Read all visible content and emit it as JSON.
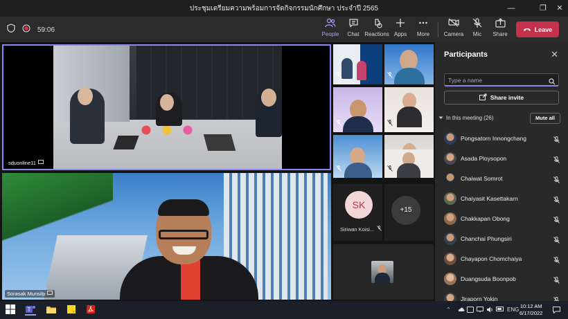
{
  "window": {
    "title": "ประชุมเตรียมความพร้อมการจัดกิจกรรมนักศึกษา ประจำปี 2565",
    "controls": [
      "minimize",
      "maximize",
      "close"
    ]
  },
  "toolbar": {
    "timer": "59:06",
    "items": [
      {
        "label": "People",
        "icon": "people-icon",
        "active": true
      },
      {
        "label": "Chat",
        "icon": "chat-icon"
      },
      {
        "label": "Reactions",
        "icon": "reactions-icon"
      },
      {
        "label": "Apps",
        "icon": "apps-icon"
      },
      {
        "label": "More",
        "icon": "more-icon"
      },
      {
        "label": "Camera",
        "icon": "camera-icon"
      },
      {
        "label": "Mic",
        "icon": "mic-off-icon"
      },
      {
        "label": "Share",
        "icon": "share-icon"
      }
    ],
    "leave_label": "Leave",
    "accent": "#c4314b"
  },
  "stage": {
    "main_tiles": [
      {
        "name": "sduonline11"
      },
      {
        "name": "Sorasak Munsilp"
      }
    ],
    "avatar_tile": {
      "initials": "SK",
      "name": "Siriwan Koisi..."
    },
    "overflow_count": "+15"
  },
  "participants": {
    "title": "Participants",
    "search_placeholder": "Type a name",
    "share_invite_label": "Share invite",
    "in_meeting_label": "In this meeting (26)",
    "mute_all_label": "Mute all",
    "list": [
      {
        "name": "Pongsatorn Innongchang"
      },
      {
        "name": "Asada Ploysopon"
      },
      {
        "name": "Chaiwat Somrot"
      },
      {
        "name": "Chaiyasit Kasettakarn"
      },
      {
        "name": "Chakkapan Obong"
      },
      {
        "name": "Chanchai Phungsiri"
      },
      {
        "name": "Chayapon Chomchaiya"
      },
      {
        "name": "Duangsuda Boonpob"
      },
      {
        "name": "Jiraporn Yokin"
      }
    ]
  },
  "taskbar": {
    "language": "ENG",
    "time": "10:12 AM",
    "date": "6/17/2022"
  }
}
